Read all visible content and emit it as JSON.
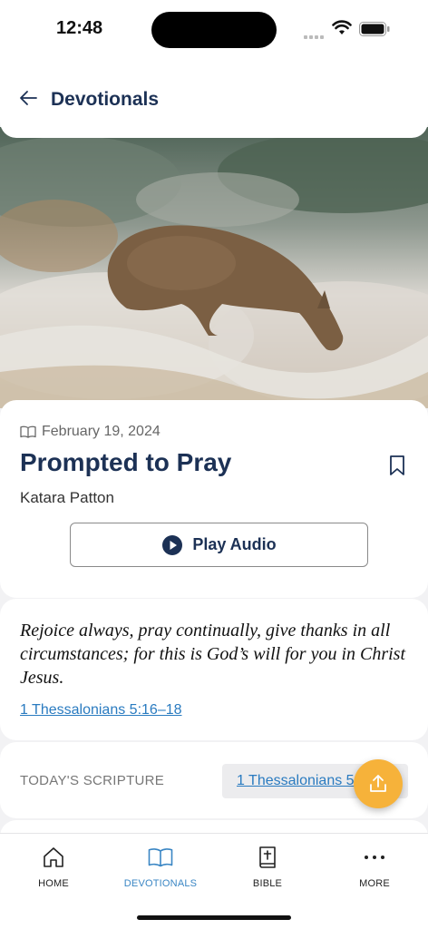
{
  "status_bar": {
    "time": "12:48"
  },
  "header": {
    "title": "Devotionals"
  },
  "article": {
    "date": "February 19, 2024",
    "title": "Prompted to Pray",
    "author": "Katara Patton",
    "play_label": "Play Audio"
  },
  "verse": {
    "text": "Rejoice always, pray continually, give thanks in all circumstances; for this is God’s will for you in Christ Jesus.",
    "reference": "1 Thessalonians 5:16–18"
  },
  "scripture": {
    "label": "TODAY'S SCRIPTURE",
    "reference": "1 Thessalonians 5:16–18"
  },
  "tabs": [
    {
      "label": "HOME",
      "icon": "home-icon"
    },
    {
      "label": "DEVOTIONALS",
      "icon": "open-book-icon"
    },
    {
      "label": "BIBLE",
      "icon": "bible-icon"
    },
    {
      "label": "MORE",
      "icon": "more-icon"
    }
  ],
  "colors": {
    "accent": "#3a86c4",
    "title": "#1c3155",
    "fab": "#f6b23a",
    "link": "#2a7bc0"
  }
}
